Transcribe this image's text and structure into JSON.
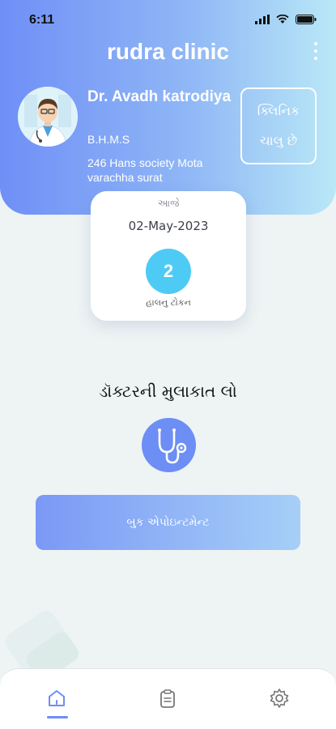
{
  "status": {
    "time": "6:11"
  },
  "header": {
    "title": "rudra clinic"
  },
  "doctor": {
    "name": "Dr. Avadh katrodiya",
    "degree": "B.H.M.S",
    "address": "246 Hans society Mota varachha surat"
  },
  "clinic_status": {
    "line1": "ક્લિનિક",
    "line2": "ચાલુ છે"
  },
  "token_card": {
    "today_label": "આજે",
    "date": "02-May-2023",
    "token_number": "2",
    "token_label": "હાલનુ ટોકન"
  },
  "visit": {
    "title": "ડૉક્ટરની મુલાકાત લો"
  },
  "book_button": {
    "label": "બુક એપોઇન્ટમેન્ટ"
  },
  "nav": {
    "items": [
      {
        "icon": "home-icon",
        "active": true
      },
      {
        "icon": "clipboard-icon",
        "active": false
      },
      {
        "icon": "gear-icon",
        "active": false
      }
    ]
  },
  "colors": {
    "accent": "#6d8ef5",
    "token_circle": "#4ecbf5",
    "header_gradient_start": "#6f8ff7",
    "header_gradient_end": "#b9e8f7"
  }
}
